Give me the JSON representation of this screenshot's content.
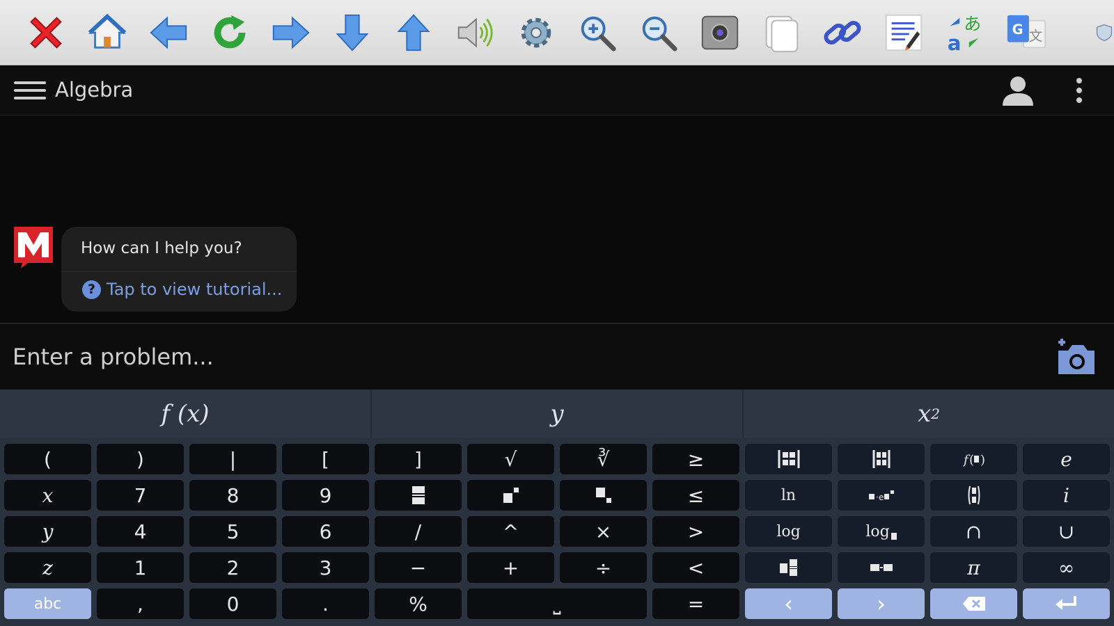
{
  "toolbar": {
    "buttons": [
      {
        "name": "close-icon"
      },
      {
        "name": "home-icon"
      },
      {
        "name": "back-icon"
      },
      {
        "name": "refresh-icon"
      },
      {
        "name": "forward-icon"
      },
      {
        "name": "scroll-down-icon"
      },
      {
        "name": "scroll-up-icon"
      },
      {
        "name": "speaker-icon"
      },
      {
        "name": "settings-gear-icon"
      },
      {
        "name": "zoom-in-icon"
      },
      {
        "name": "zoom-out-icon"
      },
      {
        "name": "screenshot-camera-icon"
      },
      {
        "name": "copy-page-icon"
      },
      {
        "name": "link-icon"
      },
      {
        "name": "edit-note-icon"
      },
      {
        "name": "translate-kana-icon"
      },
      {
        "name": "google-translate-icon"
      },
      {
        "name": "shield-icon"
      }
    ]
  },
  "appbar": {
    "title": "Algebra"
  },
  "chat": {
    "message": "How can I help you?",
    "tutorial_link": "Tap to view tutorial...",
    "help_glyph": "?"
  },
  "input": {
    "placeholder": "Enter a problem..."
  },
  "keyboard": {
    "tabs": {
      "fx": "f (x)",
      "y": "y",
      "x2_base": "x",
      "x2_exp": "2"
    },
    "keys": {
      "lparen": "(",
      "rparen": ")",
      "bar": "|",
      "lbrack": "[",
      "rbrack": "]",
      "sqrt": "√",
      "cbrt": "∛",
      "gte": "≥",
      "e": "e",
      "x": "x",
      "seven": "7",
      "eight": "8",
      "nine": "9",
      "lte": "≤",
      "ln": "ln",
      "i": "i",
      "y": "y",
      "four": "4",
      "five": "5",
      "six": "6",
      "slash": "/",
      "caret": "^",
      "times": "×",
      "gt": ">",
      "log": "log",
      "logb": "log",
      "cap": "∩",
      "cup": "∪",
      "z": "z",
      "one": "1",
      "two": "2",
      "three": "3",
      "minus": "−",
      "plus": "+",
      "divide": "÷",
      "lt": "<",
      "pi": "π",
      "infinity": "∞",
      "abc": "abc",
      "comma": ",",
      "zero": "0",
      "dot": ".",
      "percent": "%",
      "space": "⎵",
      "equals": "=",
      "left": "‹",
      "right": "›"
    }
  }
}
